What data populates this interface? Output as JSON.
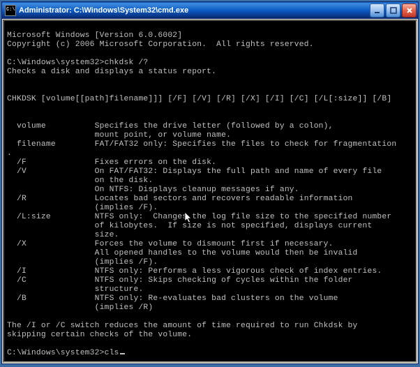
{
  "titlebar": {
    "title": "Administrator: C:\\Windows\\System32\\cmd.exe"
  },
  "console": {
    "header1": "Microsoft Windows [Version 6.0.6002]",
    "header2": "Copyright (c) 2006 Microsoft Corporation.  All rights reserved.",
    "prompt1": "C:\\Windows\\system32>chkdsk /?",
    "desc": "Checks a disk and displays a status report.",
    "syntax": "CHKDSK [volume[[path]filename]]] [/F] [/V] [/R] [/X] [/I] [/C] [/L[:size]] [/B]",
    "params": [
      {
        "name": "  volume",
        "desc": "Specifies the drive letter (followed by a colon),\nmount point, or volume name."
      },
      {
        "name": "  filename",
        "desc": "FAT/FAT32 only: Specifies the files to check for fragmentation"
      },
      {
        "name": ".",
        "desc": ""
      },
      {
        "name": "  /F",
        "desc": "Fixes errors on the disk."
      },
      {
        "name": "  /V",
        "desc": "On FAT/FAT32: Displays the full path and name of every file\non the disk.\nOn NTFS: Displays cleanup messages if any."
      },
      {
        "name": "  /R",
        "desc": "Locates bad sectors and recovers readable information\n(implies /F)."
      },
      {
        "name": "  /L:size",
        "desc": "NTFS only:  Changes the log file size to the specified number\nof kilobytes.  If size is not specified, displays current\nsize."
      },
      {
        "name": "  /X",
        "desc": "Forces the volume to dismount first if necessary.\nAll opened handles to the volume would then be invalid\n(implies /F)."
      },
      {
        "name": "  /I",
        "desc": "NTFS only: Performs a less vigorous check of index entries."
      },
      {
        "name": "  /C",
        "desc": "NTFS only: Skips checking of cycles within the folder\nstructure."
      },
      {
        "name": "  /B",
        "desc": "NTFS only: Re-evaluates bad clusters on the volume\n(implies /R)"
      }
    ],
    "footer": "The /I or /C switch reduces the amount of time required to run Chkdsk by\nskipping certain checks of the volume.",
    "prompt2_prefix": "C:\\Windows\\system32>",
    "prompt2_cmd": "cls"
  }
}
